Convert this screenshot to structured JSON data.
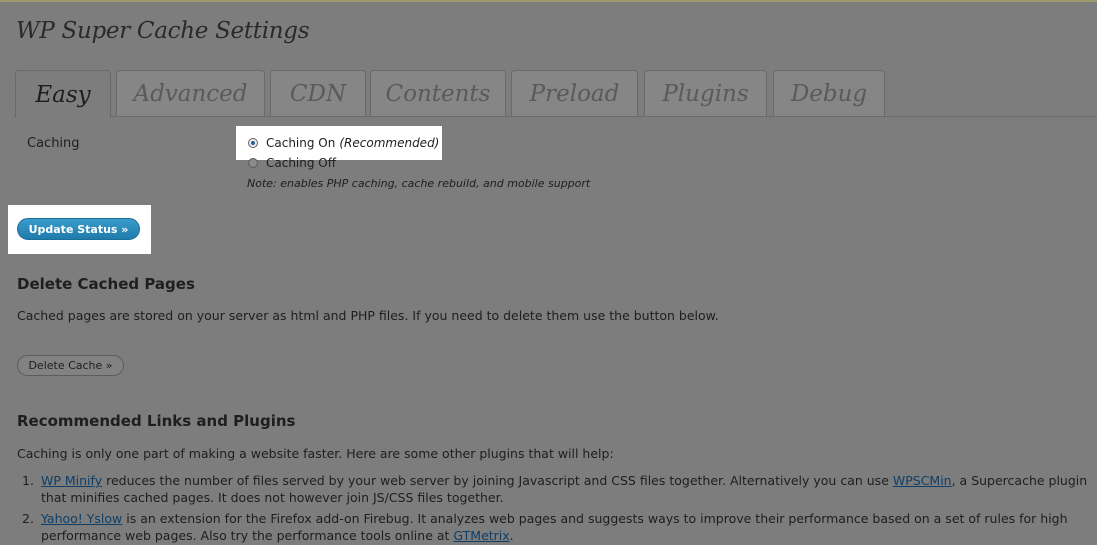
{
  "page_title": "WP Super Cache Settings",
  "tabs": [
    {
      "label": "Easy",
      "active": true
    },
    {
      "label": "Advanced",
      "active": false
    },
    {
      "label": "CDN",
      "active": false
    },
    {
      "label": "Contents",
      "active": false
    },
    {
      "label": "Preload",
      "active": false
    },
    {
      "label": "Plugins",
      "active": false
    },
    {
      "label": "Debug",
      "active": false
    }
  ],
  "caching": {
    "label": "Caching",
    "option_on": "Caching On",
    "option_on_suffix": "(Recommended)",
    "option_off": "Caching Off",
    "selected": "on",
    "note": "Note: enables PHP caching, cache rebuild, and mobile support"
  },
  "update_button": "Update Status »",
  "delete_section": {
    "heading": "Delete Cached Pages",
    "text": "Cached pages are stored on your server as html and PHP files. If you need to delete them use the button below.",
    "button": "Delete Cache »"
  },
  "recommended": {
    "heading": "Recommended Links and Plugins",
    "intro": "Caching is only one part of making a website faster. Here are some other plugins that will help:",
    "items": [
      {
        "num": "1.",
        "link1": "WP Minify",
        "text1": " reduces the number of files served by your web server by joining Javascript and CSS files together. Alternatively you can use ",
        "link2": "WPSCMin",
        "text2": ", a Supercache plugin that minifies cached pages. It does not however join JS/CSS files together."
      },
      {
        "num": "2.",
        "link1": "Yahoo! Yslow",
        "text1": " is an extension for the Firefox add-on Firebug. It analyzes web pages and suggests ways to improve their performance based on a set of rules for high performance web pages. Also try the performance tools online at ",
        "link2": "GTMetrix",
        "text2": "."
      }
    ]
  },
  "colors": {
    "page_background": "#7d7d7d",
    "highlight": "#ffffff",
    "primary_button": "#2387ba",
    "link": "#0f3f66"
  }
}
